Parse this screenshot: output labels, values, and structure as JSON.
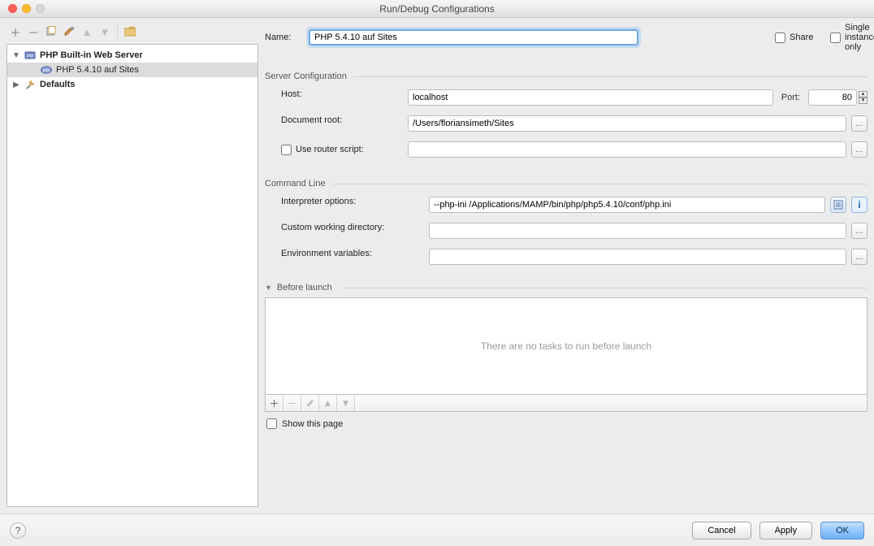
{
  "window": {
    "title": "Run/Debug Configurations"
  },
  "tree": {
    "root_label": "PHP Built-in Web Server",
    "child_label": "PHP 5.4.10 auf Sites",
    "defaults_label": "Defaults"
  },
  "name": {
    "label": "Name:",
    "value": "PHP 5.4.10 auf Sites"
  },
  "share": {
    "label": "Share"
  },
  "single_instance": {
    "label": "Single instance only"
  },
  "server_config": {
    "title": "Server Configuration",
    "host_label": "Host:",
    "host_value": "localhost",
    "port_label": "Port:",
    "port_value": "80",
    "docroot_label": "Document root:",
    "docroot_value": "/Users/floriansimeth/Sites",
    "router_label": "Use router script:",
    "router_value": ""
  },
  "command_line": {
    "title": "Command Line",
    "intopt_label": "Interpreter options:",
    "intopt_value": "--php-ini /Applications/MAMP/bin/php/php5.4.10/conf/php.ini",
    "cwd_label": "Custom working directory:",
    "cwd_value": "",
    "env_label": "Environment variables:",
    "env_value": ""
  },
  "before_launch": {
    "title": "Before launch",
    "empty_text": "There are no tasks to run before launch",
    "show_page_label": "Show this page"
  },
  "buttons": {
    "cancel": "Cancel",
    "apply": "Apply",
    "ok": "OK"
  }
}
